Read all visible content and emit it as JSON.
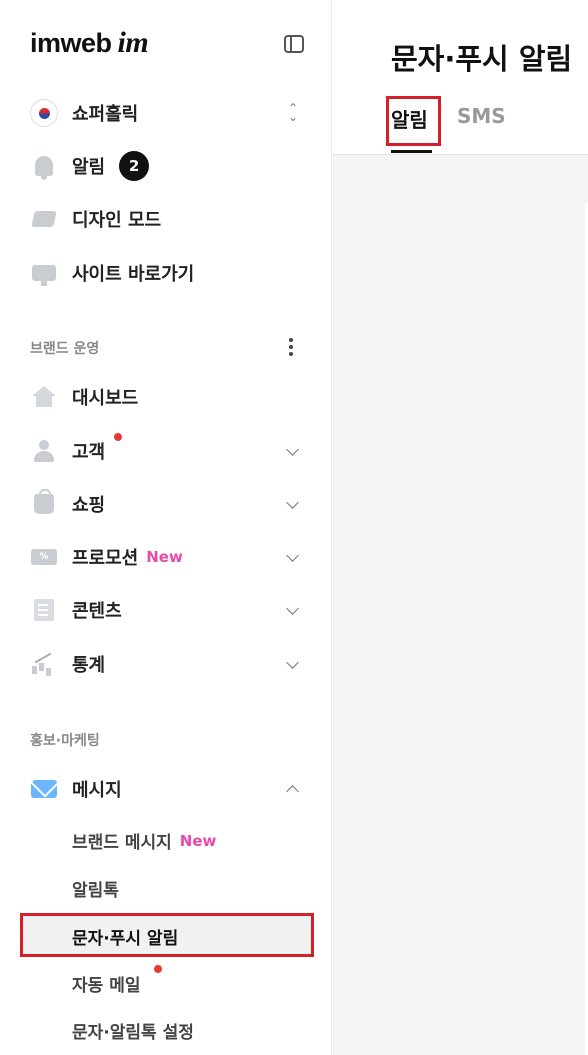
{
  "brand": {
    "logo_text": "imweb",
    "logo_mark": "im"
  },
  "site": {
    "name": "쇼퍼홀릭"
  },
  "top_items": {
    "notifications": {
      "label": "알림",
      "count": "2"
    },
    "design_mode": {
      "label": "디자인 모드"
    },
    "go_to_site": {
      "label": "사이트 바로가기"
    }
  },
  "brand_ops": {
    "title": "브랜드 운영",
    "items": [
      {
        "label": "대시보드"
      },
      {
        "label": "고객"
      },
      {
        "label": "쇼핑"
      },
      {
        "label": "프로모션",
        "badge": "New"
      },
      {
        "label": "콘텐츠"
      },
      {
        "label": "통계"
      }
    ]
  },
  "marketing": {
    "title": "홍보·마케팅",
    "message": {
      "label": "메시지"
    },
    "subitems": [
      {
        "label": "브랜드 메시지",
        "badge": "New"
      },
      {
        "label": "알림톡"
      },
      {
        "label": "문자·푸시 알림"
      },
      {
        "label": "자동 메일"
      },
      {
        "label": "문자·알림톡 설정"
      }
    ]
  },
  "coupon_icon_text": "%",
  "main": {
    "title": "문자·푸시 알림",
    "tabs": [
      {
        "label": "알림"
      },
      {
        "label": "SMS"
      }
    ]
  },
  "colors": {
    "accent_red": "#d32029",
    "new_pink": "#e84aab",
    "mail_blue": "#6bb6ff"
  }
}
